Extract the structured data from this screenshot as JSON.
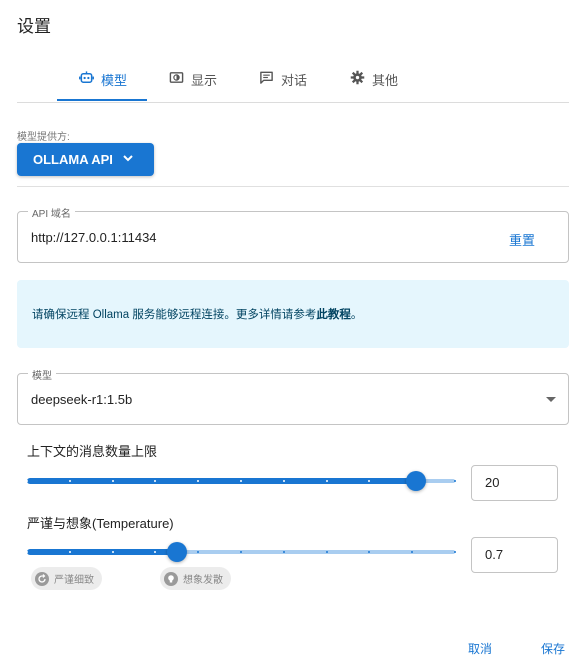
{
  "dialog": {
    "title": "设置"
  },
  "tabs": [
    {
      "label": "模型",
      "icon": "robot-icon",
      "active": true
    },
    {
      "label": "显示",
      "icon": "display-icon",
      "active": false
    },
    {
      "label": "对话",
      "icon": "chat-icon",
      "active": false
    },
    {
      "label": "其他",
      "icon": "gear-icon",
      "active": false
    }
  ],
  "provider": {
    "label": "模型提供方:",
    "selected": "OLLAMA API"
  },
  "api_domain": {
    "label": "API 域名",
    "value": "http://127.0.0.1:11434",
    "reset_label": "重置"
  },
  "info": {
    "text": "请确保远程 Ollama 服务能够远程连接。更多详情请参考",
    "link": "此教程",
    "end": "。"
  },
  "model": {
    "label": "模型",
    "value": "deepseek-r1:1.5b"
  },
  "context_limit": {
    "title": "上下文的消息数量上限",
    "value": "20",
    "fraction": 0.91,
    "marks": 11
  },
  "temperature": {
    "title": "严谨与想象(Temperature)",
    "value": "0.7",
    "fraction": 0.35,
    "chip_left": "严谨细致",
    "chip_right": "想象发散"
  },
  "footer": {
    "cancel": "取消",
    "save": "保存"
  },
  "colors": {
    "accent": "#1976d2",
    "info_bg": "#e5f6fd",
    "rail": "#a9cdf0"
  }
}
